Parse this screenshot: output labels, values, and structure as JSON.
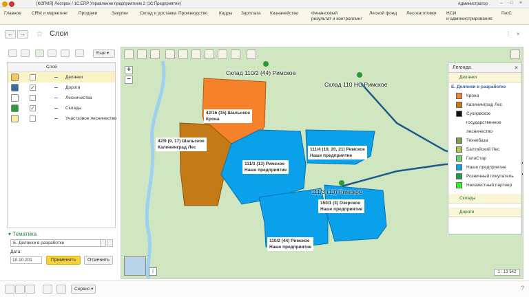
{
  "titlebar": {
    "title": "[КОПИЯ] Леспрон / 1С:ERP Управление предприятием 2  (1С:Предприятие)",
    "user": "Администратор"
  },
  "menu": [
    "Главное",
    "CRM и маркетинг",
    "Продажи",
    "Закупки",
    "Склад и доставка",
    "Производство",
    "Кадры",
    "Зарплата",
    "Казначейство",
    "Финансовый\nрезультат и контроллинг",
    "Лесной фонд",
    "Лесозаготовки",
    "НСИ\nи администрирование",
    "ГеоС"
  ],
  "page": {
    "title": "Слои"
  },
  "layers": {
    "header": "Слой",
    "more_label": "Еще",
    "rows": [
      {
        "label": "Делянки",
        "checked": false,
        "icon_color": "#f0c860"
      },
      {
        "label": "Дороги",
        "checked": true,
        "icon_color": "#3a6ea0"
      },
      {
        "label": "Лесничества",
        "checked": false,
        "icon_color": "#ffffff"
      },
      {
        "label": "Склады",
        "checked": true,
        "icon_color": "#2a9a3a"
      },
      {
        "label": "Участковое лесничество",
        "checked": false,
        "icon_color": "#f7f0a0"
      }
    ]
  },
  "thematics": {
    "title": "Тематика",
    "value": "Е. Делянки в разработке",
    "date_label": "Дата:",
    "date_value": "10.10.201",
    "apply": "Применить",
    "cancel": "Отменить"
  },
  "map": {
    "warehouse_labels": [
      "Склад 110/2 (44) Римское",
      "Склад 110 НС Римское",
      "111/3 (13) Римское"
    ],
    "plots": [
      {
        "line1": "42/16 (15) Шальское",
        "line2": "Крона"
      },
      {
        "line1": "42/9 (9, 17) Шальское",
        "line2": "Калининград Лес"
      },
      {
        "line1": "111/3 (13) Римское",
        "line2": "Наше предприятие"
      },
      {
        "line1": "111/4 (19, 20, 21) Римское",
        "line2": "Наше предприятие"
      },
      {
        "line1": "150/1 (3) Озерское",
        "line2": "Наше предприятие"
      },
      {
        "line1": "110/2 (44) Римское",
        "line2": "Наше предприятие"
      }
    ],
    "scale": "1 : 13 542",
    "colors": {
      "krona": "#f5822a",
      "kaliningrad": "#c47a16",
      "ours": "#0aa0ea",
      "road": "#1e5a8a",
      "warehouse": "#2a9a3a",
      "ground": "#d0e6c0"
    }
  },
  "legend": {
    "title": "Легенда",
    "section_plots": "Делянки",
    "subtitle": "Е. Делянки в разработке",
    "items": [
      {
        "label": "Крона",
        "color": "#f5822a"
      },
      {
        "label": "Калининград Лес",
        "color": "#c47a16"
      },
      {
        "label": "Суоярвское\nгосударственное\nлесничество",
        "color": "#111111"
      },
      {
        "label": "Технобаза",
        "color": "#7aa04a"
      },
      {
        "label": "Балтийский Лес",
        "color": "#a8c85a"
      },
      {
        "label": "ГалаСтар",
        "color": "#6ad070"
      },
      {
        "label": "Наше предприятие",
        "color": "#0aa0ea"
      },
      {
        "label": "Розничный покупатель",
        "color": "#1aa048"
      },
      {
        "label": "Неизвестный партнер",
        "color": "#22ff22"
      }
    ],
    "section_warehouses": "Склады",
    "section_roads": "Дороги"
  },
  "bottom": {
    "servis": "Сервис"
  }
}
